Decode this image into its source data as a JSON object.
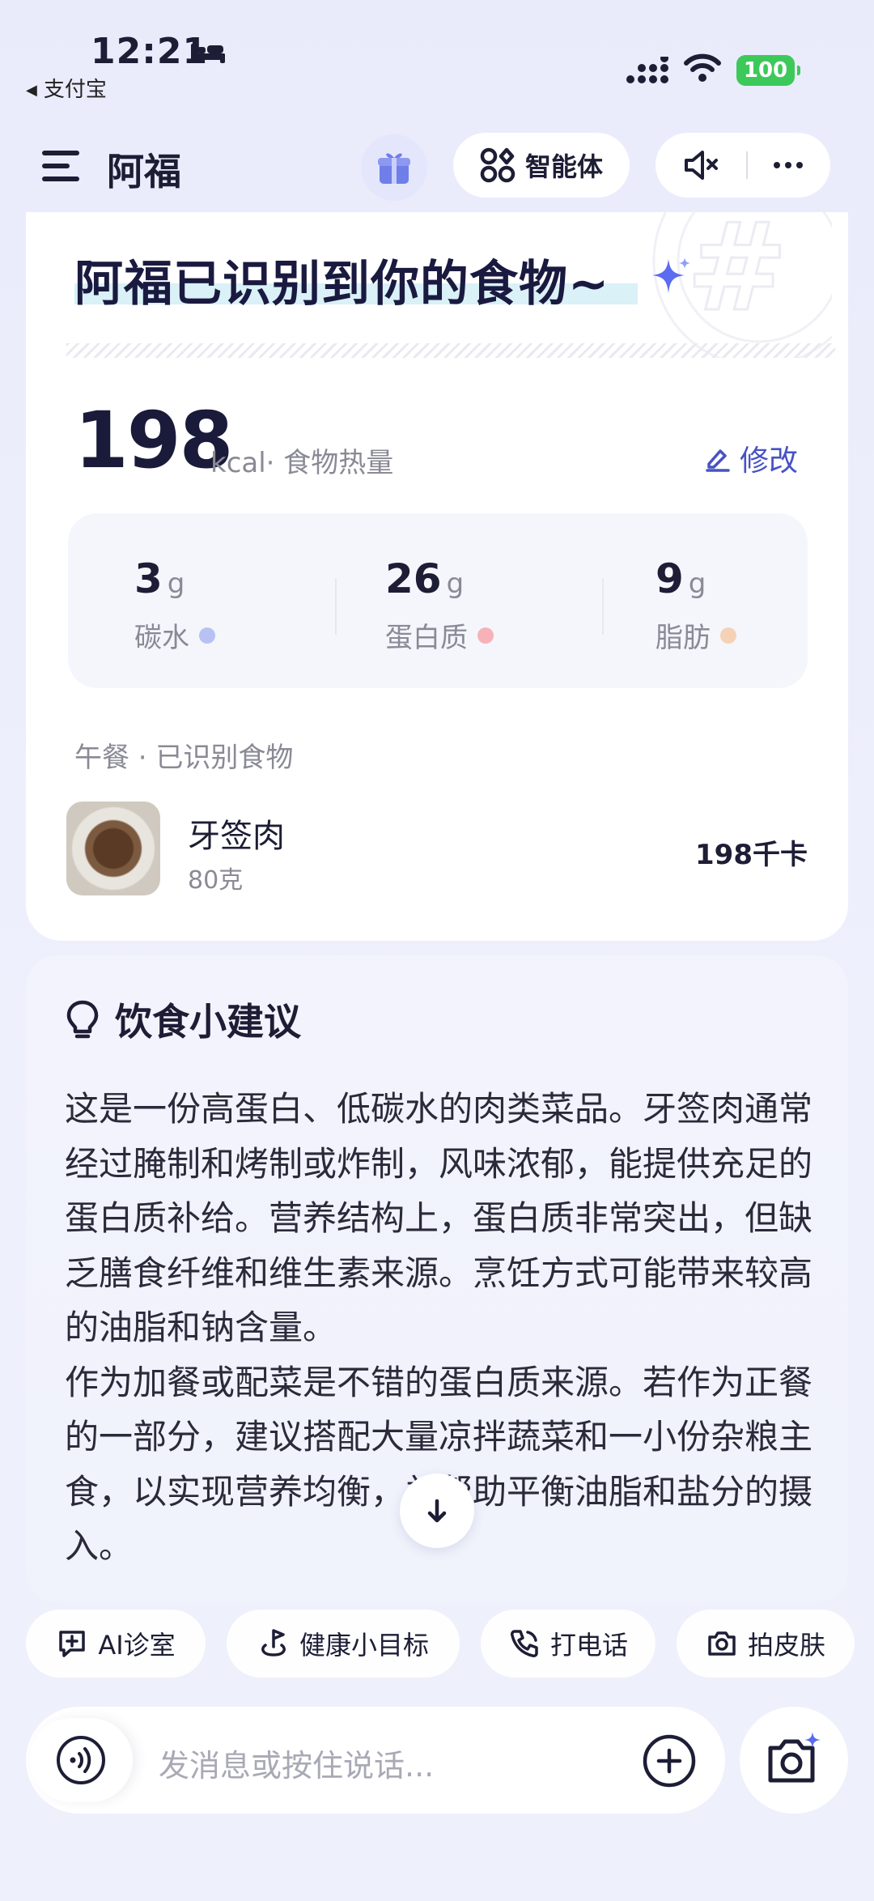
{
  "status_bar": {
    "time": "12:21",
    "back_app": "支付宝",
    "battery": "100",
    "colors": {
      "battery": "#3dc95a"
    }
  },
  "header": {
    "title": "阿福",
    "agent_label": "智能体"
  },
  "result": {
    "headline": "阿福已识别到你的食物~",
    "kcal_value": "198",
    "kcal_unit": "kcal",
    "kcal_label": "· 食物热量",
    "edit_label": "修改",
    "macros": [
      {
        "value": "3",
        "unit": "g",
        "name": "碳水",
        "dot_color": "#b8c2f2"
      },
      {
        "value": "26",
        "unit": "g",
        "name": "蛋白质",
        "dot_color": "#f6b2b8"
      },
      {
        "value": "9",
        "unit": "g",
        "name": "脂肪",
        "dot_color": "#f5d2b6"
      }
    ],
    "meal_label": "午餐 · 已识别食物",
    "food": {
      "name": "牙签肉",
      "weight": "80克",
      "kcal": "198千卡"
    }
  },
  "advice": {
    "title": "饮食小建议",
    "paragraphs": [
      "这是一份高蛋白、低碳水的肉类菜品。牙签肉通常经过腌制和烤制或炸制，风味浓郁，能提供充足的蛋白质补给。营养结构上，蛋白质非常突出，但缺乏膳食纤维和维生素来源。烹饪方式可能带来较高的油脂和钠含量。",
      "作为加餐或配菜是不错的蛋白质来源。若作为正餐的一部分，建议搭配大量凉拌蔬菜和一小份杂粮主食，以实现营养均衡，并帮助平衡油脂和盐分的摄入。"
    ]
  },
  "quick_actions": [
    {
      "label": "AI诊室",
      "icon": "chat-plus-icon"
    },
    {
      "label": "健康小目标",
      "icon": "target-flag-icon"
    },
    {
      "label": "打电话",
      "icon": "phone-icon"
    },
    {
      "label": "拍皮肤",
      "icon": "camera-icon"
    }
  ],
  "input": {
    "placeholder": "发消息或按住说话..."
  },
  "colors": {
    "accent": "#4752c4",
    "text_dark": "#1d1d35",
    "text_muted": "#8a8a96",
    "sparkle": "#5b6cf0"
  }
}
